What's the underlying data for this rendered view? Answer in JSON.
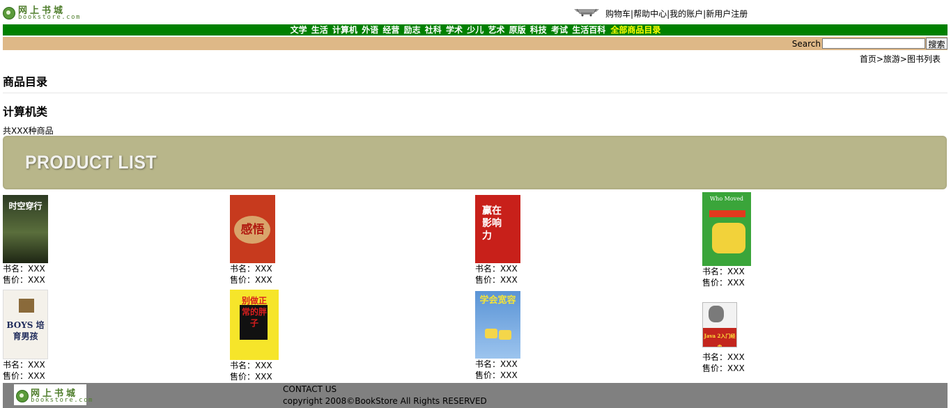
{
  "header": {
    "logo_cn": "网上书城",
    "logo_en": "bookstore.com",
    "links": [
      "购物车",
      "帮助中心",
      "我的账户",
      "新用户注册"
    ],
    "separator": "|"
  },
  "nav": {
    "categories": [
      "文学",
      "生活",
      "计算机",
      "外语",
      "经营",
      "励志",
      "社科",
      "学术",
      "少儿",
      "艺术",
      "原版",
      "科技",
      "考试",
      "生活百科"
    ],
    "all_label": "全部商品目录",
    "colors": {
      "bar": "#008000",
      "all": "#ffff00"
    }
  },
  "search": {
    "label": "Search",
    "button": "搜索",
    "value": "",
    "bar_color": "#deb887"
  },
  "breadcrumb": {
    "items": [
      "首页",
      "旅游",
      "图书列表"
    ],
    "separator": ">"
  },
  "catalog_title": "商品目录",
  "category_title": "计算机类",
  "count_text": "共XXX种商品",
  "banner_text": "PRODUCT LIST",
  "products": [
    {
      "cover": "时空穿行",
      "name_label": "书名：",
      "name": "XXX",
      "price_label": "售价：",
      "price": "XXX"
    },
    {
      "cover": "感悟",
      "name_label": "书名：",
      "name": "XXX",
      "price_label": "售价：",
      "price": "XXX"
    },
    {
      "cover": "赢在影响力",
      "name_label": "书名：",
      "name": "XXX",
      "price_label": "售价：",
      "price": "XXX"
    },
    {
      "cover": "Who Moved",
      "name_label": "书名：",
      "name": "XXX",
      "price_label": "售价：",
      "price": "XXX"
    },
    {
      "cover": "BOYS 培育男孩",
      "name_label": "书名：",
      "name": "XXX",
      "price_label": "售价：",
      "price": "XXX"
    },
    {
      "cover": "别做正常的胖子",
      "name_label": "书名：",
      "name": "XXX",
      "price_label": "售价：",
      "price": "XXX"
    },
    {
      "cover": "学会宽容",
      "name_label": "书名：",
      "name": "XXX",
      "price_label": "售价：",
      "price": "XXX"
    },
    {
      "cover": "Java 2入门经典",
      "name_label": "书名：",
      "name": "XXX",
      "price_label": "售价：",
      "price": "XXX"
    }
  ],
  "footer": {
    "contact": "CONTACT US",
    "copyright": "copyright 2008©BookStore All Rights RESERVED"
  }
}
